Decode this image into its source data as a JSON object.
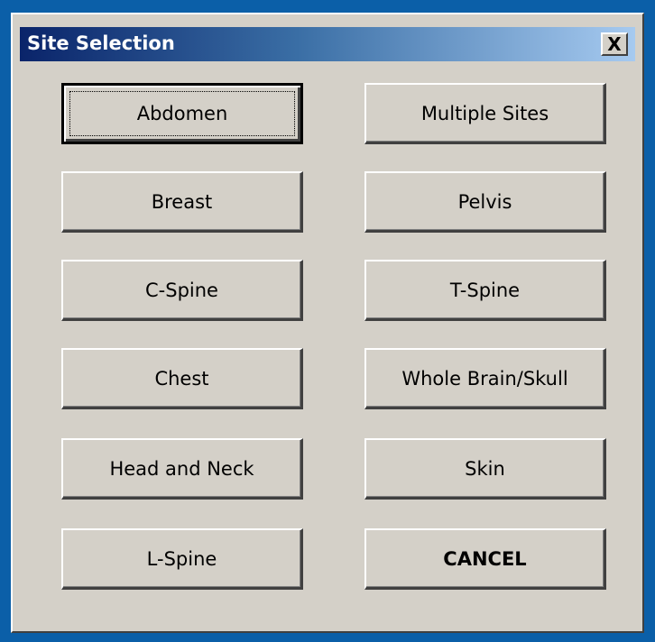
{
  "window": {
    "title": "Site Selection",
    "close_label": "X"
  },
  "buttons": {
    "left": [
      {
        "label": "Abdomen"
      },
      {
        "label": "Breast"
      },
      {
        "label": "C-Spine"
      },
      {
        "label": "Chest"
      },
      {
        "label": "Head and Neck"
      },
      {
        "label": "L-Spine"
      }
    ],
    "right": [
      {
        "label": "Multiple Sites"
      },
      {
        "label": "Pelvis"
      },
      {
        "label": "T-Spine"
      },
      {
        "label": "Whole Brain/Skull"
      },
      {
        "label": "Skin"
      },
      {
        "label": "CANCEL"
      }
    ]
  },
  "colors": {
    "frame": "#0b5fa8",
    "dialog_bg": "#d4d0c8",
    "titlebar_start": "#0a246a",
    "titlebar_end": "#a6caf0"
  }
}
